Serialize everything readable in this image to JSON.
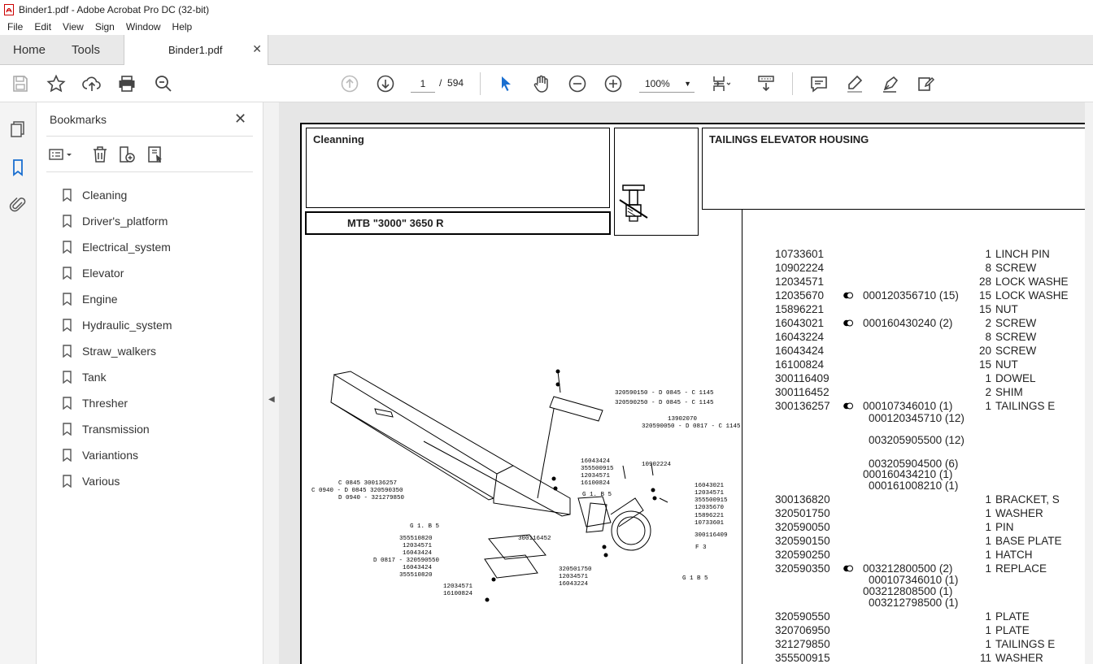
{
  "window": {
    "title": "Binder1.pdf - Adobe Acrobat Pro DC (32-bit)"
  },
  "menu": [
    "File",
    "Edit",
    "View",
    "Sign",
    "Window",
    "Help"
  ],
  "tabs": {
    "home": "Home",
    "tools": "Tools",
    "document": "Binder1.pdf"
  },
  "toolbar": {
    "page_current": "1",
    "page_sep": "/",
    "page_total": "594",
    "zoom": "100%"
  },
  "bookmarks": {
    "title": "Bookmarks",
    "items": [
      "Cleaning",
      "Driver's_platform",
      "Electrical_system",
      "Elevator",
      "Engine",
      "Hydraulic_system",
      "Straw_walkers",
      "Tank",
      "Thresher",
      "Transmission",
      "Variantions",
      "Various"
    ]
  },
  "doc": {
    "section": "Cleanning",
    "model": "MTB \"3000\" 3650 R",
    "heading": "TAILINGS ELEVATOR HOUSING",
    "parts": [
      {
        "pn": "10733601",
        "dot": false,
        "alt": "",
        "qty": "1",
        "desc": "LINCH PIN"
      },
      {
        "pn": "10902224",
        "dot": false,
        "alt": "",
        "qty": "8",
        "desc": "SCREW"
      },
      {
        "pn": "12034571",
        "dot": false,
        "alt": "",
        "qty": "28",
        "desc": "LOCK WASHE"
      },
      {
        "pn": "12035670",
        "dot": true,
        "alt": "000120356710  (15)",
        "qty": "15",
        "desc": "LOCK WASHE"
      },
      {
        "pn": "15896221",
        "dot": false,
        "alt": "",
        "qty": "15",
        "desc": "NUT"
      },
      {
        "pn": "16043021",
        "dot": true,
        "alt": "000160430240  (2)",
        "qty": "2",
        "desc": "SCREW"
      },
      {
        "pn": "16043224",
        "dot": false,
        "alt": "",
        "qty": "8",
        "desc": "SCREW"
      },
      {
        "pn": "16043424",
        "dot": false,
        "alt": "",
        "qty": "20",
        "desc": "SCREW"
      },
      {
        "pn": "16100824",
        "dot": false,
        "alt": "",
        "qty": "15",
        "desc": "NUT"
      },
      {
        "pn": "300116409",
        "dot": false,
        "alt": "",
        "qty": "1",
        "desc": "DOWEL"
      },
      {
        "pn": "300116452",
        "dot": false,
        "alt": "",
        "qty": "2",
        "desc": "SHIM"
      },
      {
        "pn": "300136257",
        "dot": true,
        "alt": "000107346010  (1)",
        "qty": "1",
        "desc": "TAILINGS E"
      }
    ],
    "alt_lines_1": [
      "000120345710  (12)",
      "003205905500  (12)",
      "003205904500  (6)",
      "000160434210  (1)",
      "000161008210  (1)"
    ],
    "parts2": [
      {
        "pn": "300136820",
        "dot": false,
        "alt": "",
        "qty": "1",
        "desc": "BRACKET, S"
      },
      {
        "pn": "320501750",
        "dot": false,
        "alt": "",
        "qty": "1",
        "desc": "WASHER"
      },
      {
        "pn": "320590050",
        "dot": false,
        "alt": "",
        "qty": "1",
        "desc": "PIN"
      },
      {
        "pn": "320590150",
        "dot": false,
        "alt": "",
        "qty": "1",
        "desc": "BASE PLATE"
      },
      {
        "pn": "320590250",
        "dot": false,
        "alt": "",
        "qty": "1",
        "desc": "HATCH"
      },
      {
        "pn": "320590350",
        "dot": true,
        "alt": "003212800500  (2)",
        "qty": "1",
        "desc": "REPLACE"
      }
    ],
    "alt_lines_2": [
      "000107346010  (1)",
      "003212808500  (1)",
      "003212798500  (1)"
    ],
    "parts3": [
      {
        "pn": "320590550",
        "qty": "1",
        "desc": "PLATE"
      },
      {
        "pn": "320706950",
        "qty": "1",
        "desc": "PLATE"
      },
      {
        "pn": "321279850",
        "qty": "1",
        "desc": "TAILINGS E"
      },
      {
        "pn": "355500915",
        "qty": "11",
        "desc": "WASHER"
      }
    ],
    "drawing_labels": [
      "320590150 - D 0845 - C 1145",
      "320590250 - D 0845 - C 1145",
      "13902070",
      "320590050 - D 0817 - C 1145",
      "16043424",
      "355500915",
      "12034571",
      "16100824",
      "10902224",
      "G 1. B 5",
      "C 0845  300136257",
      "C 0940 - D 0845  320590350",
      "D 0940 - 321279850",
      "16043021",
      "12034571",
      "355500915",
      "12035670",
      "15896221",
      "10733601",
      "300116409",
      "G 1. B 5",
      "355510820",
      "12034571",
      "16043424",
      "D 0817 - 320590550",
      "16043424",
      "355510820",
      "300116452",
      "320501750",
      "12034571",
      "16043224",
      "12034571",
      "16100824",
      "F 3",
      "G 1 B 5"
    ]
  }
}
